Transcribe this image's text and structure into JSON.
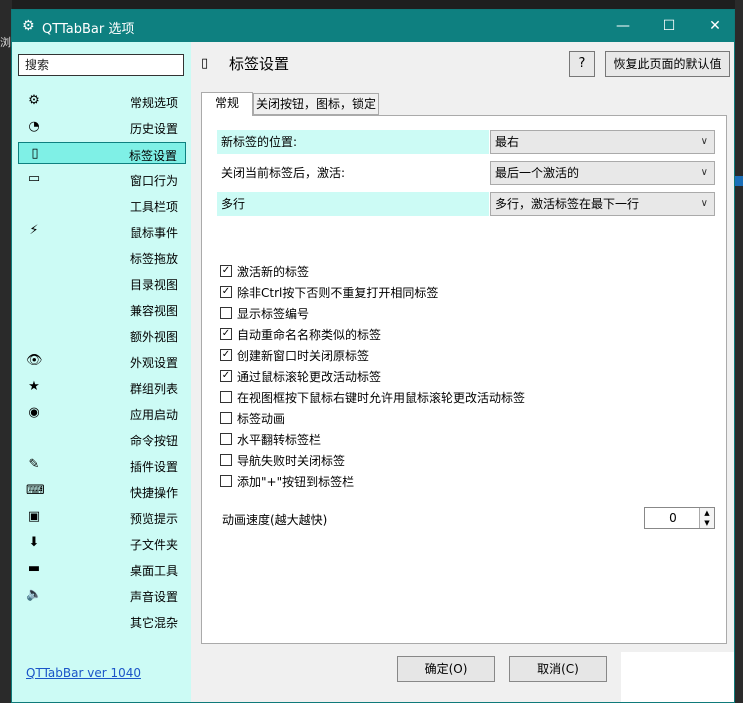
{
  "background": {
    "left_text": "浏"
  },
  "window": {
    "title": "QTTabBar 选项",
    "icon": "gear-icon",
    "controls": {
      "minimize": "—",
      "maximize": "☐",
      "close": "✕"
    }
  },
  "sidebar": {
    "search_placeholder": "搜索",
    "items": [
      {
        "label": "常规选项",
        "icon": "gear-icon",
        "glyph": "⚙"
      },
      {
        "label": "历史设置",
        "icon": "history-icon",
        "glyph": "◔"
      },
      {
        "label": "标签设置",
        "icon": "tab-icon",
        "glyph": "▯"
      },
      {
        "label": "窗口行为",
        "icon": "window-icon",
        "glyph": "▭"
      },
      {
        "label": "工具栏项",
        "icon": "",
        "glyph": ""
      },
      {
        "label": "鼠标事件",
        "icon": "lightning-icon",
        "glyph": "⚡"
      },
      {
        "label": "标签拖放",
        "icon": "",
        "glyph": ""
      },
      {
        "label": "目录视图",
        "icon": "",
        "glyph": ""
      },
      {
        "label": "兼容视图",
        "icon": "",
        "glyph": ""
      },
      {
        "label": "额外视图",
        "icon": "",
        "glyph": ""
      },
      {
        "label": "外观设置",
        "icon": "eye-icon",
        "glyph": "👁"
      },
      {
        "label": "群组列表",
        "icon": "star-icon",
        "glyph": "★"
      },
      {
        "label": "应用启动",
        "icon": "app-launch-icon",
        "glyph": "◉"
      },
      {
        "label": "命令按钮",
        "icon": "",
        "glyph": ""
      },
      {
        "label": "插件设置",
        "icon": "plugin-icon",
        "glyph": "✎"
      },
      {
        "label": "快捷操作",
        "icon": "keyboard-icon",
        "glyph": "⌨"
      },
      {
        "label": "预览提示",
        "icon": "preview-icon",
        "glyph": "▣"
      },
      {
        "label": "子文件夹",
        "icon": "down-arrow-icon",
        "glyph": "⬇"
      },
      {
        "label": "桌面工具",
        "icon": "desktop-icon",
        "glyph": "▬"
      },
      {
        "label": "声音设置",
        "icon": "speaker-icon",
        "glyph": "🔈"
      },
      {
        "label": "其它混杂",
        "icon": "",
        "glyph": ""
      }
    ],
    "selected_index": 2,
    "version_link": "QTTabBar ver 1040"
  },
  "main": {
    "page_icon": "tab-icon",
    "page_title": "标签设置",
    "help_label": "?",
    "reset_label": "恢复此页面的默认值",
    "tabs": [
      {
        "label": "常规",
        "active": true
      },
      {
        "label": "关闭按钮，图标，锁定",
        "active": false
      }
    ],
    "dropdowns": [
      {
        "label": "新标签的位置:",
        "value": "最右",
        "highlight": true
      },
      {
        "label": "关闭当前标签后，激活:",
        "value": "最后一个激活的",
        "highlight": false
      },
      {
        "label": "多行",
        "value": "多行，激活标签在最下一行",
        "highlight": true
      }
    ],
    "checkboxes": [
      {
        "label": "激活新的标签",
        "checked": true
      },
      {
        "label": "除非Ctrl按下否则不重复打开相同标签",
        "checked": true
      },
      {
        "label": "显示标签编号",
        "checked": false
      },
      {
        "label": "自动重命名名称类似的标签",
        "checked": true
      },
      {
        "label": "创建新窗口时关闭原标签",
        "checked": true
      },
      {
        "label": "通过鼠标滚轮更改活动标签",
        "checked": true
      },
      {
        "label": "在视图框按下鼠标右键时允许用鼠标滚轮更改活动标签",
        "checked": false
      },
      {
        "label": "标签动画",
        "checked": false
      },
      {
        "label": "水平翻转标签栏",
        "checked": false
      },
      {
        "label": "导航失败时关闭标签",
        "checked": false
      },
      {
        "label": "添加\"+\"按钮到标签栏",
        "checked": false
      }
    ],
    "anim_speed": {
      "label": "动画速度(越大越快)",
      "value": "0",
      "up": "▲",
      "down": "▼"
    },
    "ok_label": "确定(O)",
    "cancel_label": "取消(C)"
  }
}
